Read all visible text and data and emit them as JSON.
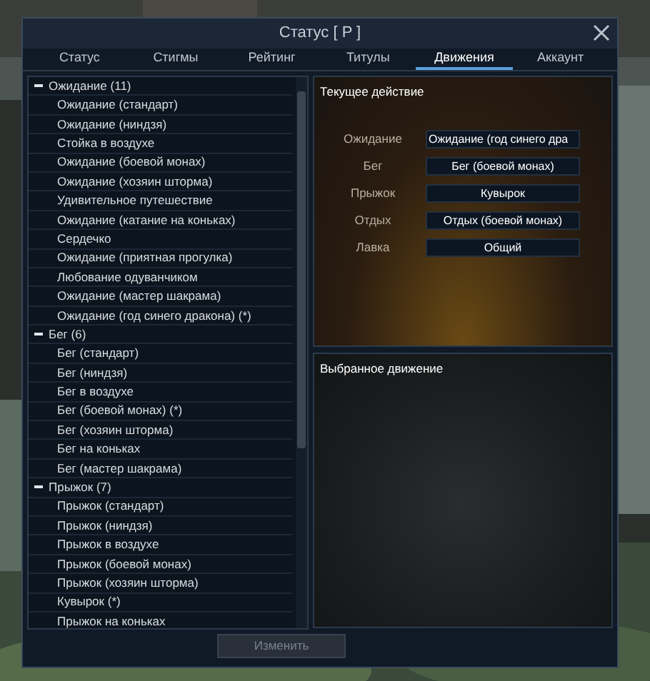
{
  "window": {
    "title": "Статус [ P ]"
  },
  "tabs": [
    {
      "label": "Статус",
      "selected": false
    },
    {
      "label": "Стигмы",
      "selected": false
    },
    {
      "label": "Рейтинг",
      "selected": false
    },
    {
      "label": "Титулы",
      "selected": false
    },
    {
      "label": "Движения",
      "selected": true
    },
    {
      "label": "Аккаунт",
      "selected": false
    }
  ],
  "motion_list": [
    {
      "label": "Ожидание (11)",
      "expanded": true,
      "children": [
        "Ожидание (стандарт)",
        "Ожидание (ниндзя)",
        "Стойка в воздухе",
        "Ожидание (боевой монах)",
        "Ожидание (хозяин шторма)",
        "Удивительное путешествие",
        "Ожидание (катание на коньках)",
        "Сердечко",
        "Ожидание (приятная прогулка)",
        "Любование одуванчиком",
        "Ожидание (мастер шакрама)",
        "Ожидание (год синего дракона) (*)"
      ]
    },
    {
      "label": "Бег (6)",
      "expanded": true,
      "children": [
        "Бег (стандарт)",
        "Бег (ниндзя)",
        "Бег в воздухе",
        "Бег (боевой монах) (*)",
        "Бег (хозяин шторма)",
        "Бег на коньках",
        "Бег (мастер шакрама)"
      ]
    },
    {
      "label": "Прыжок (7)",
      "expanded": true,
      "children": [
        "Прыжок (стандарт)",
        "Прыжок (ниндзя)",
        "Прыжок в воздухе",
        "Прыжок (боевой монах)",
        "Прыжок (хозяин шторма)",
        "Кувырок (*)",
        "Прыжок на коньках"
      ]
    }
  ],
  "current_action": {
    "title": "Текущее действие",
    "rows": [
      {
        "label": "Ожидание",
        "value": "Ожидание (год синего дра"
      },
      {
        "label": "Бег",
        "value": "Бег (боевой монах)"
      },
      {
        "label": "Прыжок",
        "value": "Кувырок"
      },
      {
        "label": "Отдых",
        "value": "Отдых (боевой монах)"
      },
      {
        "label": "Лавка",
        "value": "Общий"
      }
    ]
  },
  "selected_motion": {
    "title": "Выбранное движение"
  },
  "buttons": [
    {
      "label": "Изменить",
      "disabled": true
    }
  ]
}
